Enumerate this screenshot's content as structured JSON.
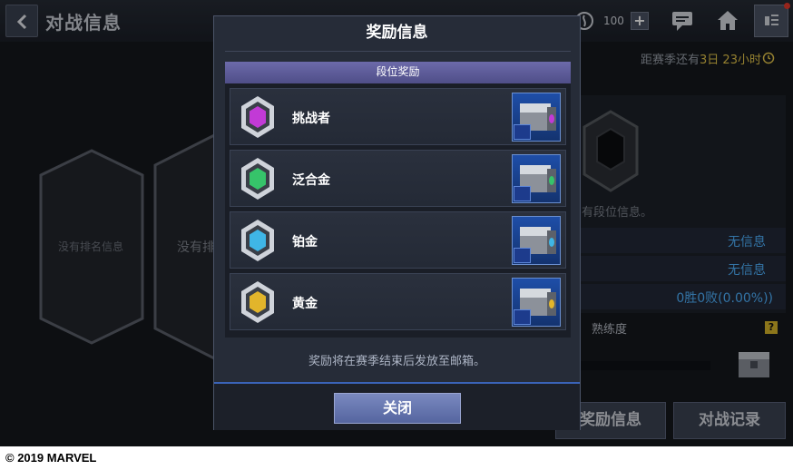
{
  "header": {
    "title": "对战信息",
    "currency_value": "100",
    "plus_label": "+"
  },
  "background": {
    "no_rank_info": "没有排名信息",
    "no_rank_info_partial": "没有排",
    "season_prefix": "距赛季还有",
    "season_remaining": "3日 23小时",
    "no_tier_info": "有段位信息。",
    "stats": [
      "无信息",
      "无信息",
      "0胜0败(0.00%))"
    ],
    "mastery_label": "熟练度",
    "help_label": "?",
    "bottom_buttons": [
      "奖励信息",
      "对战记录"
    ]
  },
  "modal": {
    "title": "奖励信息",
    "section_title": "段位奖励",
    "tiers": [
      {
        "name": "挑战者",
        "gem_color": "#c23ad6"
      },
      {
        "name": "泛合金",
        "gem_color": "#36c46a"
      },
      {
        "name": "铂金",
        "gem_color": "#3fb6e6"
      },
      {
        "name": "黄金",
        "gem_color": "#e2b52b"
      }
    ],
    "note": "奖励将在赛季结束后发放至邮箱。",
    "close_label": "关闭"
  },
  "footer": {
    "copyright": "© 2019 MARVEL"
  }
}
